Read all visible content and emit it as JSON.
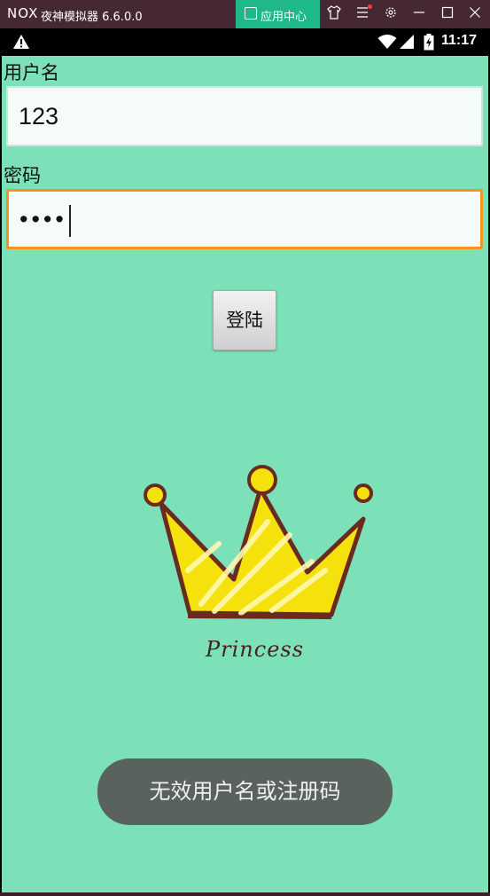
{
  "window": {
    "logo": "NOX",
    "title": "夜神模拟器 6.6.0.0",
    "app_center_label": "应用中心",
    "icons": [
      "shirt-icon",
      "menu-icon",
      "settings-icon",
      "minimize-icon",
      "maximize-icon",
      "close-icon"
    ]
  },
  "statusbar": {
    "time": "11:17",
    "icons": [
      "warning-icon",
      "wifi-icon",
      "signal-icon",
      "battery-charging-icon"
    ]
  },
  "form": {
    "username_label": "用户名",
    "username_value": "123",
    "password_label": "密码",
    "password_value": "••••",
    "login_button": "登陆"
  },
  "image": {
    "caption": "Princess",
    "description_icon": "crown-icon"
  },
  "toast": {
    "message": "无效用户名或注册码"
  },
  "colors": {
    "app_background": "#7ce0b8",
    "focus_border": "#f59322",
    "app_center": "#1fb88a",
    "titlebar": "#452833",
    "toast": "#5a625d"
  }
}
